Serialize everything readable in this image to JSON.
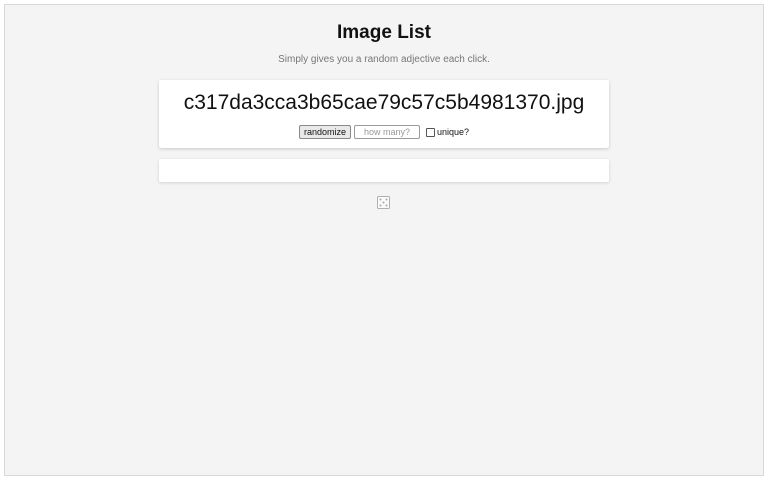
{
  "page": {
    "title": "Image List",
    "subtitle": "Simply gives you a random adjective each click."
  },
  "generator": {
    "result": "c317da3cca3b65cae79c57c5b4981370.jpg",
    "randomize_label": "randomize",
    "count_placeholder": "how many?",
    "count_value": "",
    "unique_label": "unique?",
    "unique_checked": false
  },
  "list": {
    "items": []
  },
  "icons": {
    "footer": "dice-icon"
  },
  "colors": {
    "background": "#f4f4f4",
    "card": "#ffffff"
  }
}
